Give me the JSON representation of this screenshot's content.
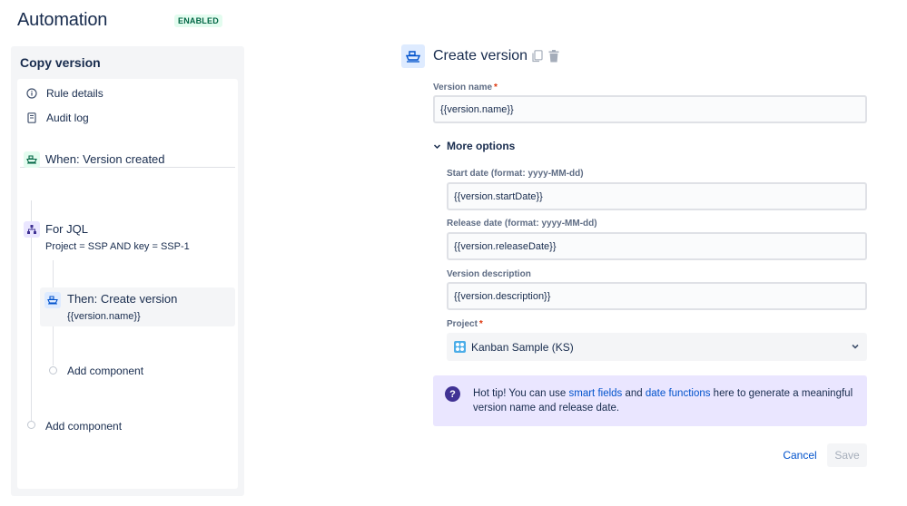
{
  "header": {
    "title": "Automation",
    "status": "ENABLED"
  },
  "sidebar": {
    "title": "Copy version",
    "links": [
      {
        "label": "Rule details",
        "icon": "info-icon"
      },
      {
        "label": "Audit log",
        "icon": "document-icon"
      }
    ],
    "trigger": {
      "title": "When: Version created",
      "icon": "ship-icon"
    },
    "branch": {
      "title": "For JQL",
      "subtitle": "Project = SSP AND key = SSP-1",
      "icon": "branch-icon"
    },
    "action": {
      "title": "Then: Create version",
      "subtitle": "{{version.name}}",
      "icon": "ship-icon"
    },
    "add_component_inner": "Add component",
    "add_component_outer": "Add component"
  },
  "form": {
    "title": "Create version",
    "version_name": {
      "label": "Version name",
      "value": "{{version.name}}",
      "required": "*"
    },
    "more_options": "More options",
    "start_date": {
      "label": "Start date (format: yyyy-MM-dd)",
      "value": "{{version.startDate}}"
    },
    "release_date": {
      "label": "Release date (format: yyyy-MM-dd)",
      "value": "{{version.releaseDate}}"
    },
    "description": {
      "label": "Version description",
      "value": "{{version.description}}"
    },
    "project": {
      "label": "Project",
      "value": "Kanban Sample (KS)",
      "required": "*"
    },
    "tip": {
      "prefix": "Hot tip! You can use ",
      "link1": "smart fields",
      "middle": " and ",
      "link2": "date functions",
      "suffix": " here to generate a meaningful version name and release date."
    },
    "cancel_label": "Cancel",
    "save_label": "Save"
  },
  "colors": {
    "accent": "#0052cc",
    "enabled_bg": "#e3fcef",
    "enabled_text": "#006644",
    "tip_bg": "#eae6ff",
    "tip_icon": "#403294",
    "required": "#de350b"
  }
}
